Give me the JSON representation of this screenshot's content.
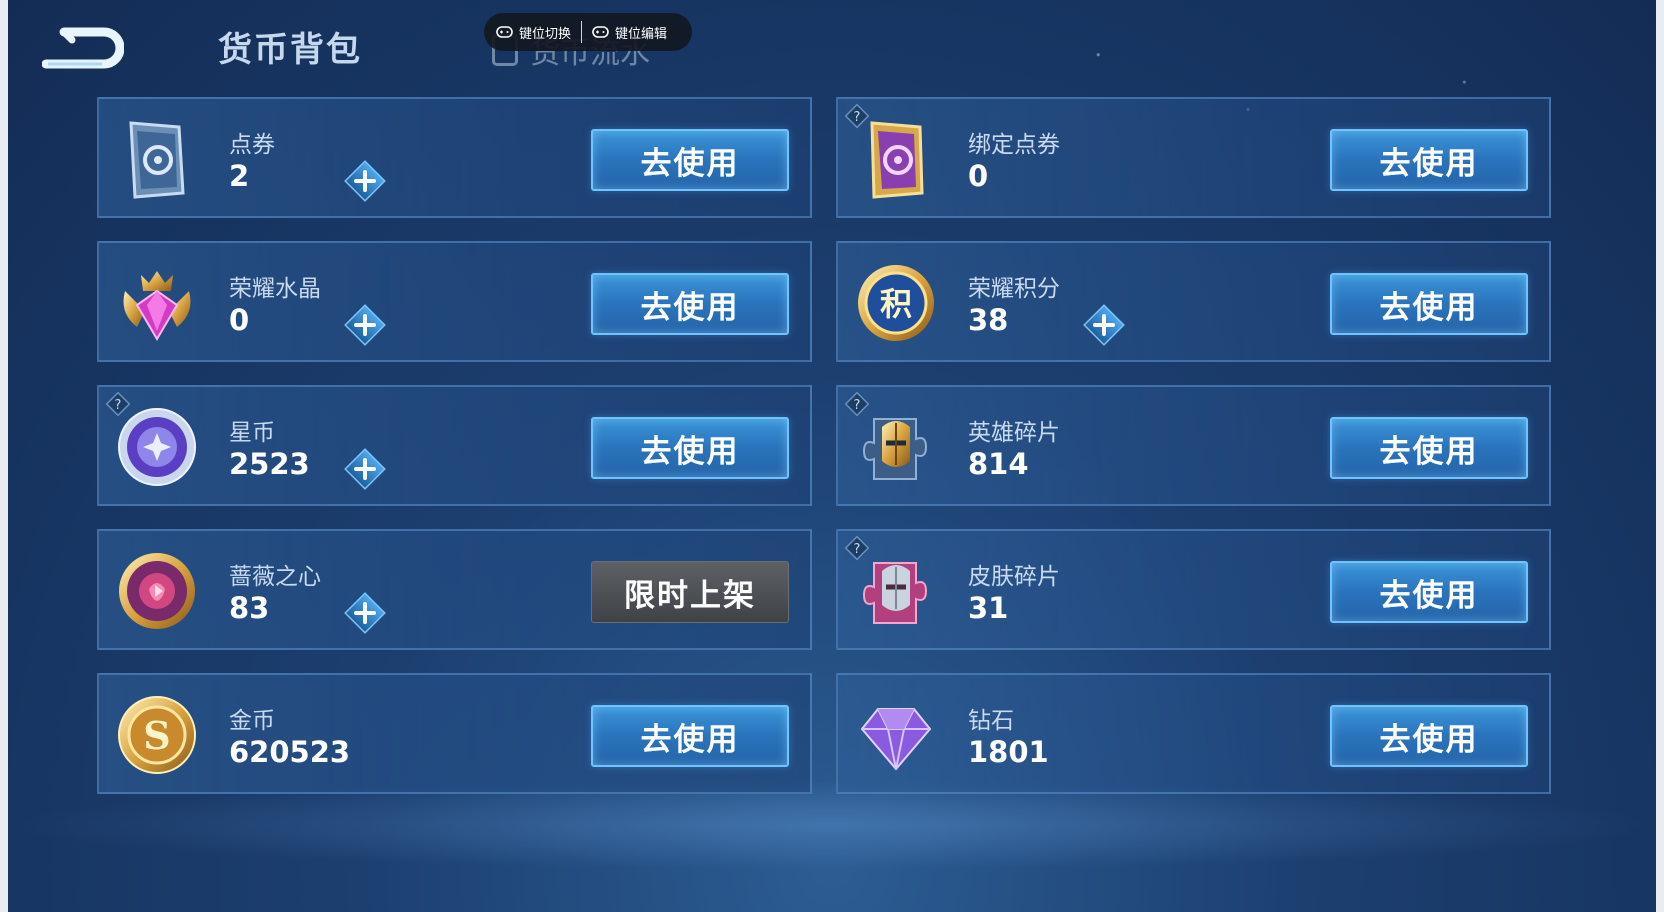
{
  "header": {
    "title": "货币背包",
    "sub_tab": "货币流水"
  },
  "key_overlay": {
    "switch_label": "键位切换",
    "edit_label": "键位编辑"
  },
  "use_label": "去使用",
  "limited_label": "限时上架",
  "currencies": [
    {
      "name": "点券",
      "value": "2",
      "icon": "coupon-icon"
    },
    {
      "name": "绑定点券",
      "value": "0",
      "icon": "bound-coupon-icon"
    },
    {
      "name": "荣耀水晶",
      "value": "0",
      "icon": "glory-crystal-icon"
    },
    {
      "name": "荣耀积分",
      "value": "38",
      "icon": "glory-points-icon",
      "icon_char": "积"
    },
    {
      "name": "星币",
      "value": "2523",
      "icon": "star-coin-icon"
    },
    {
      "name": "英雄碎片",
      "value": "814",
      "icon": "hero-fragment-icon"
    },
    {
      "name": "蔷薇之心",
      "value": "83",
      "icon": "rose-heart-icon"
    },
    {
      "name": "皮肤碎片",
      "value": "31",
      "icon": "skin-fragment-icon"
    },
    {
      "name": "金币",
      "value": "620523",
      "icon": "gold-coin-icon",
      "icon_char": "S"
    },
    {
      "name": "钻石",
      "value": "1801",
      "icon": "diamond-icon"
    }
  ],
  "colors": {
    "button_blue": "#2a74bd",
    "button_border": "#6fc4ff",
    "limited_gray": "#4a4d52",
    "label_text": "#c9d9ee"
  }
}
